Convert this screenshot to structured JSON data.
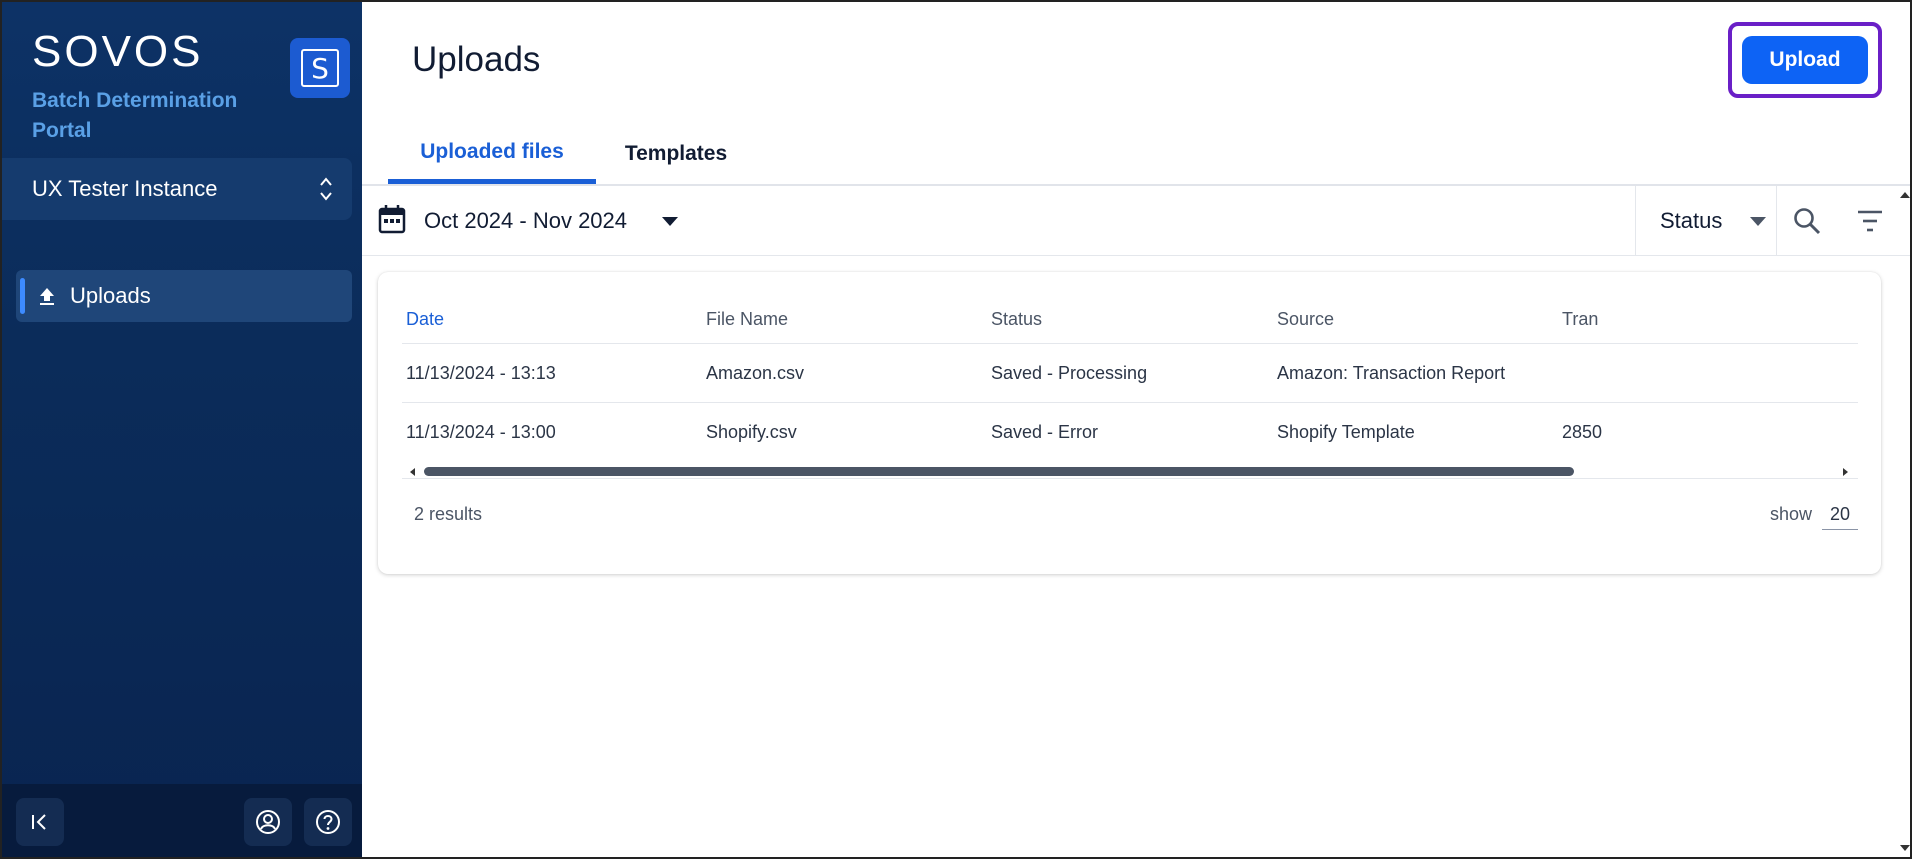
{
  "sidebar": {
    "brand": "SOVOS",
    "portal_name": "Batch Determination Portal",
    "badge_letter": "S",
    "instance": "UX Tester Instance",
    "nav_items": [
      {
        "label": "Uploads",
        "icon": "upload-icon",
        "active": true
      }
    ],
    "footer_icons": [
      "collapse-sidebar-icon",
      "account-icon",
      "help-icon"
    ]
  },
  "header": {
    "title": "Uploads",
    "upload_button": "Upload"
  },
  "tabs": [
    {
      "label": "Uploaded files",
      "active": true
    },
    {
      "label": "Templates",
      "active": false
    }
  ],
  "toolbar": {
    "date_range": "Oct 2024 - Nov 2024",
    "status_filter": "Status",
    "icons": [
      "calendar-icon",
      "search-icon",
      "filter-icon"
    ]
  },
  "table": {
    "columns": [
      "Date",
      "File Name",
      "Status",
      "Source",
      "Tran"
    ],
    "rows": [
      [
        "11/13/2024 - 13:13",
        "Amazon.csv",
        "Saved - Processing",
        "Amazon: Transaction Report",
        ""
      ],
      [
        "11/13/2024 - 13:00",
        "Shopify.csv",
        "Saved - Error",
        "Shopify Template",
        "2850"
      ]
    ]
  },
  "footer": {
    "results": "2 results",
    "show_label": "show",
    "page_size": "20"
  },
  "colors": {
    "sidebar_bg": "#0b2c5a",
    "accent": "#1a5fd6",
    "upload_button": "#0d63f5",
    "upload_focus_ring": "#6a1fc7",
    "portal_text": "#5aa0e6"
  }
}
